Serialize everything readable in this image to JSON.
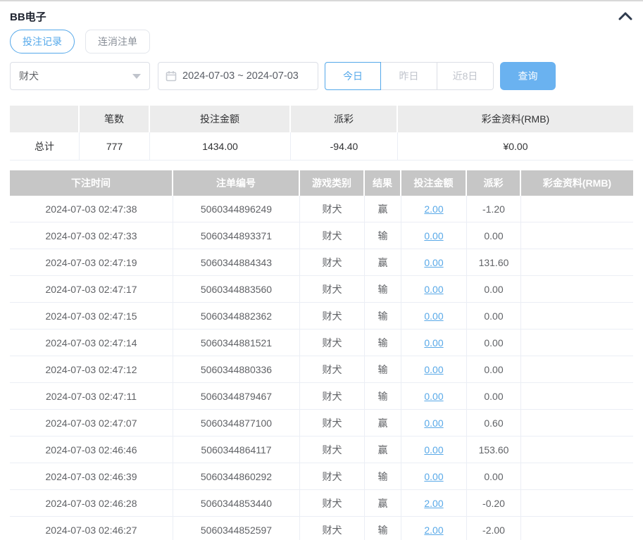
{
  "panel": {
    "title": "BB电子"
  },
  "tabs": [
    {
      "label": "投注记录",
      "active": true
    },
    {
      "label": "连消注单",
      "active": false
    }
  ],
  "filters": {
    "game_select": {
      "value": "财犬"
    },
    "date_range": {
      "value": "2024-07-03 ~ 2024-07-03"
    },
    "quick_buttons": [
      {
        "label": "今日",
        "active": true
      },
      {
        "label": "昨日",
        "active": false
      },
      {
        "label": "近8日",
        "active": false
      }
    ],
    "query_label": "查询"
  },
  "summary": {
    "headers": {
      "col0": "",
      "col1": "笔数",
      "col2": "投注金额",
      "col3": "派彩",
      "col4": "彩金资料(RMB)"
    },
    "row": {
      "label": "总计",
      "count": "777",
      "bet_amount": "1434.00",
      "payout": "-94.40",
      "bonus": "¥0.00"
    }
  },
  "table": {
    "headers": {
      "time": "下注时间",
      "order": "注单编号",
      "game": "游戏类别",
      "result": "结果",
      "bet": "投注金额",
      "payout": "派彩",
      "bonus": "彩金资料(RMB)"
    },
    "rows": [
      {
        "time": "2024-07-03 02:47:38",
        "order_id": "5060344896249",
        "game": "财犬",
        "result": "赢",
        "bet_amount": "2.00",
        "payout": "-1.20",
        "bonus": ""
      },
      {
        "time": "2024-07-03 02:47:33",
        "order_id": "5060344893371",
        "game": "财犬",
        "result": "输",
        "bet_amount": "0.00",
        "payout": "0.00",
        "bonus": ""
      },
      {
        "time": "2024-07-03 02:47:19",
        "order_id": "5060344884343",
        "game": "财犬",
        "result": "赢",
        "bet_amount": "0.00",
        "payout": "131.60",
        "bonus": ""
      },
      {
        "time": "2024-07-03 02:47:17",
        "order_id": "5060344883560",
        "game": "财犬",
        "result": "输",
        "bet_amount": "0.00",
        "payout": "0.00",
        "bonus": ""
      },
      {
        "time": "2024-07-03 02:47:15",
        "order_id": "5060344882362",
        "game": "财犬",
        "result": "输",
        "bet_amount": "0.00",
        "payout": "0.00",
        "bonus": ""
      },
      {
        "time": "2024-07-03 02:47:14",
        "order_id": "5060344881521",
        "game": "财犬",
        "result": "输",
        "bet_amount": "0.00",
        "payout": "0.00",
        "bonus": ""
      },
      {
        "time": "2024-07-03 02:47:12",
        "order_id": "5060344880336",
        "game": "财犬",
        "result": "输",
        "bet_amount": "0.00",
        "payout": "0.00",
        "bonus": ""
      },
      {
        "time": "2024-07-03 02:47:11",
        "order_id": "5060344879467",
        "game": "财犬",
        "result": "输",
        "bet_amount": "0.00",
        "payout": "0.00",
        "bonus": ""
      },
      {
        "time": "2024-07-03 02:47:07",
        "order_id": "5060344877100",
        "game": "财犬",
        "result": "赢",
        "bet_amount": "0.00",
        "payout": "0.60",
        "bonus": ""
      },
      {
        "time": "2024-07-03 02:46:46",
        "order_id": "5060344864117",
        "game": "财犬",
        "result": "赢",
        "bet_amount": "0.00",
        "payout": "153.60",
        "bonus": ""
      },
      {
        "time": "2024-07-03 02:46:39",
        "order_id": "5060344860292",
        "game": "财犬",
        "result": "输",
        "bet_amount": "0.00",
        "payout": "0.00",
        "bonus": ""
      },
      {
        "time": "2024-07-03 02:46:28",
        "order_id": "5060344853440",
        "game": "财犬",
        "result": "赢",
        "bet_amount": "2.00",
        "payout": "-0.20",
        "bonus": ""
      },
      {
        "time": "2024-07-03 02:46:27",
        "order_id": "5060344852597",
        "game": "财犬",
        "result": "输",
        "bet_amount": "2.00",
        "payout": "-2.00",
        "bonus": ""
      }
    ]
  },
  "colors": {
    "accent_blue": "#54a8ea",
    "link_blue": "#59a9e8",
    "query_button_blue": "#6ab2f0",
    "negative_red": "#f56c6c",
    "table_header_gray": "#c6c6c6",
    "summary_header_gray": "#ececec"
  }
}
